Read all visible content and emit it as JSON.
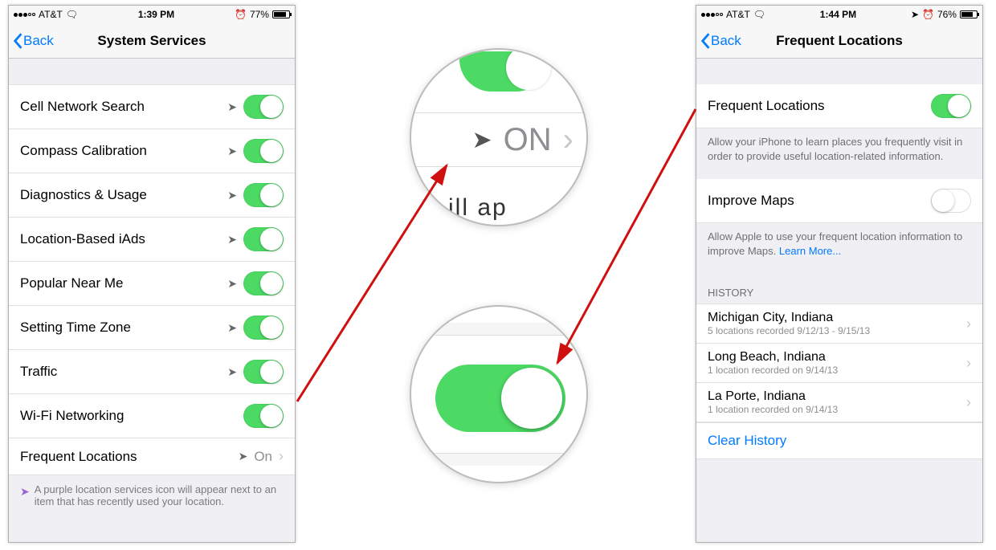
{
  "left": {
    "status": {
      "carrier": "AT&T",
      "time": "1:39 PM",
      "battery_pct": "77%"
    },
    "nav": {
      "back": "Back",
      "title": "System Services"
    },
    "items": [
      {
        "label": "Cell Network Search",
        "toggle": true,
        "arrow": true
      },
      {
        "label": "Compass Calibration",
        "toggle": true,
        "arrow": true
      },
      {
        "label": "Diagnostics & Usage",
        "toggle": true,
        "arrow": true
      },
      {
        "label": "Location-Based iAds",
        "toggle": true,
        "arrow": true
      },
      {
        "label": "Popular Near Me",
        "toggle": true,
        "arrow": true
      },
      {
        "label": "Setting Time Zone",
        "toggle": true,
        "arrow": true
      },
      {
        "label": "Traffic",
        "toggle": true,
        "arrow": true
      },
      {
        "label": "Wi-Fi Networking",
        "toggle": true,
        "arrow": false
      }
    ],
    "frequent": {
      "label": "Frequent Locations",
      "value": "On"
    },
    "footnote": "A purple location services icon will appear next to an item that has recently used your location."
  },
  "mag": {
    "on_label": "ON",
    "frag": "ill ap"
  },
  "right": {
    "status": {
      "carrier": "AT&T",
      "time": "1:44 PM",
      "battery_pct": "76%"
    },
    "nav": {
      "back": "Back",
      "title": "Frequent Locations"
    },
    "freq_toggle": {
      "label": "Frequent Locations",
      "desc": "Allow your iPhone to learn places you frequently visit in order to provide useful location-related information."
    },
    "improve": {
      "label": "Improve Maps",
      "desc_pre": "Allow Apple to use your frequent location information to improve Maps. ",
      "learn": "Learn More..."
    },
    "history_header": "HISTORY",
    "history": [
      {
        "title": "Michigan City, Indiana",
        "sub": "5 locations recorded 9/12/13 - 9/15/13"
      },
      {
        "title": "Long Beach, Indiana",
        "sub": "1 location recorded on 9/14/13"
      },
      {
        "title": "La Porte, Indiana",
        "sub": "1 location recorded on 9/14/13"
      }
    ],
    "clear": "Clear History"
  }
}
